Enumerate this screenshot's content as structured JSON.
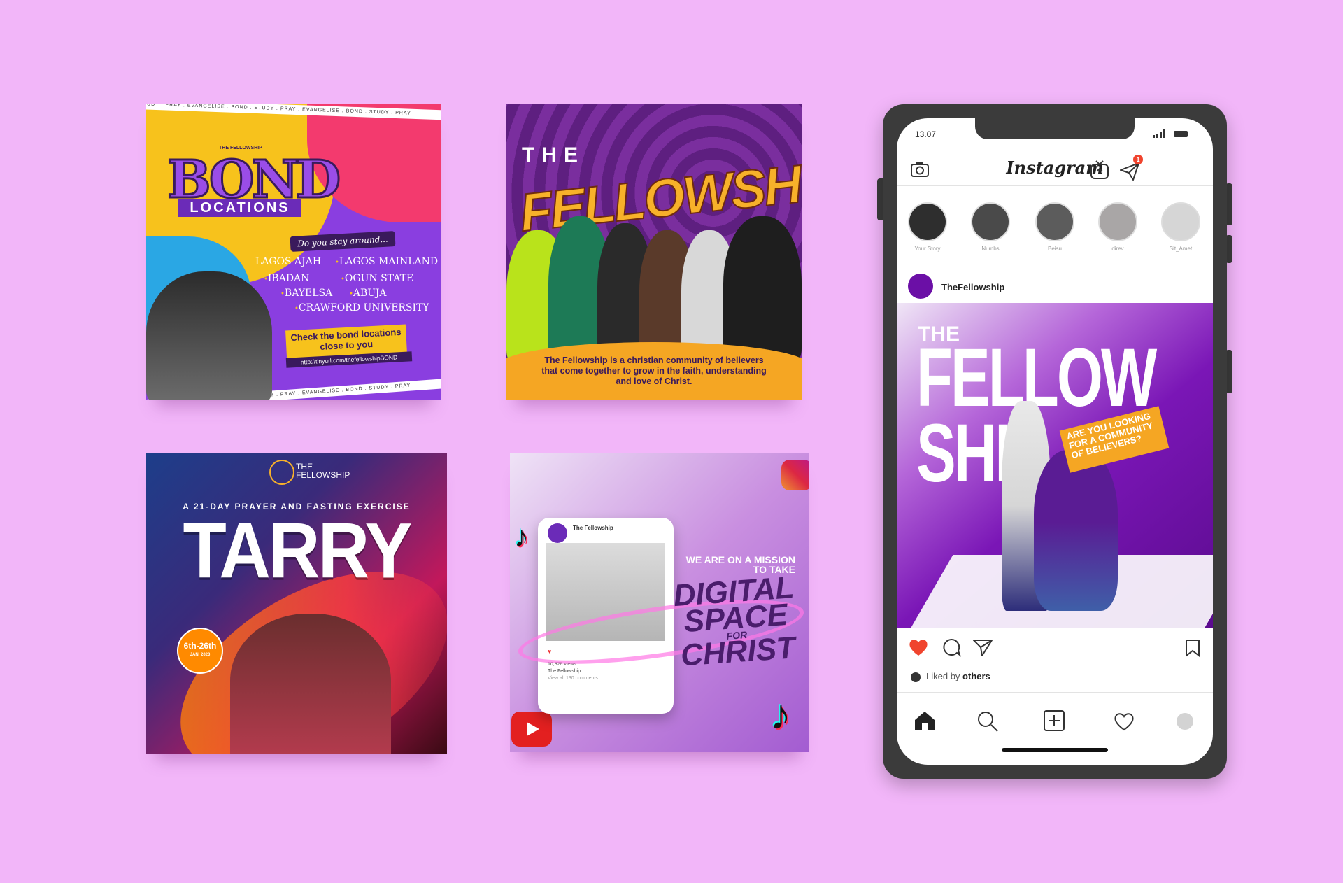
{
  "bond_card": {
    "ticker": "STUDY . PRAY . EVANGELISE . BOND . STUDY . PRAY . EVANGELISE . BOND . STUDY . PRAY",
    "logo_text": "THE FELLOWSHIP",
    "title": "BOND",
    "subtitle": "LOCATIONS",
    "prompt": "Do you stay around...",
    "locations": [
      "LAGOS AJAH",
      "LAGOS MAINLAND",
      "IBADAN",
      "OGUN STATE",
      "BAYELSA",
      "ABUJA",
      "CRAWFORD UNIVERSITY"
    ],
    "cta": "Check the bond locations close to you",
    "url": "http://tinyurl.com/thefellowshipBOND"
  },
  "fellowship_card": {
    "the": "THE",
    "title": "FELLOWSHIP",
    "caption": "The Fellowship is a christian community of believers that come together to grow in the faith, understanding and love of Christ."
  },
  "tarry_card": {
    "logo_line1": "THE",
    "logo_line2": "FELLOWSHIP",
    "subtitle": "A 21-DAY PRAYER AND FASTING EXERCISE",
    "title": "TARRY",
    "date": "6th-26th",
    "date_small": "JAN, 2023"
  },
  "digital_card": {
    "post_account": "The Fellowship",
    "post_views": "10,328 views",
    "post_caption": "The Fellowship",
    "post_comments": "View all 130 comments",
    "mission": "WE ARE ON A MISSION TO TAKE",
    "line1": "DIGITAL",
    "line2": "SPACE",
    "for": "FOR",
    "line3": "CHRIST"
  },
  "phone": {
    "time": "13.07",
    "app_title": "Instagram",
    "notification_count": "1",
    "stories": [
      {
        "label": "Your Story",
        "color": "#2e2e2e"
      },
      {
        "label": "Numbs",
        "color": "#4a4a4a"
      },
      {
        "label": "Beisu",
        "color": "#5c5c5c"
      },
      {
        "label": "direv",
        "color": "#a9a6a6"
      },
      {
        "label": "Sit_Amet",
        "color": "#d6d6d6"
      }
    ],
    "post_user": "TheFellowship",
    "post_image": {
      "the": "THE",
      "fellow": "FELLOW",
      "ship": "SHIP",
      "question": "ARE YOU LOOKING FOR A COMMUNITY OF BELIEVERS?"
    },
    "liked_prefix": "Liked by",
    "liked_by": "others",
    "accent_like": "#f0442e"
  }
}
